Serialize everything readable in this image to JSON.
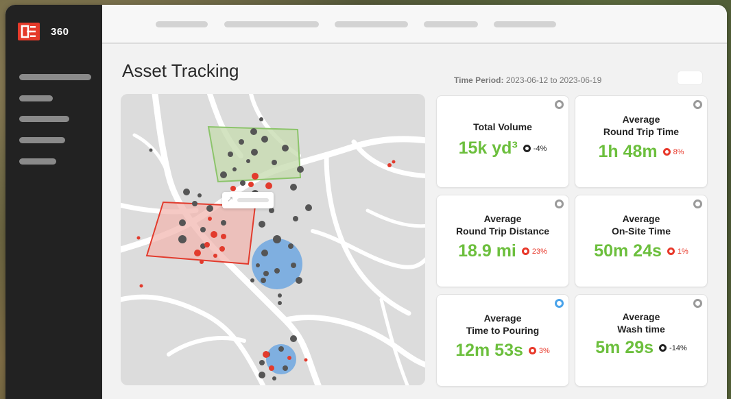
{
  "app": {
    "logo_text": "360"
  },
  "page": {
    "title": "Asset Tracking"
  },
  "time_period": {
    "label": "Time Period:",
    "value": "2023-06-12 to 2023-06-19"
  },
  "colors": {
    "accent": "#e53a2a",
    "metric_green": "#6cbf3d",
    "negative_red": "#e8382a",
    "sidebar": "#222222"
  },
  "icons": {
    "logo": "e-logo-icon",
    "card_select": "radio-icon",
    "tooltip_link": "external-link-icon"
  },
  "metrics": [
    {
      "title": "Total Volume",
      "value": "15k yd³",
      "change": "-4%",
      "trend": "black",
      "selected": false
    },
    {
      "title": "Average\nRound Trip Time",
      "value": "1h 48m",
      "change": "8%",
      "trend": "red",
      "selected": false
    },
    {
      "title": "Average\nRound Trip Distance",
      "value": "18.9 mi",
      "change": "23%",
      "trend": "red",
      "selected": false
    },
    {
      "title": "Average\nOn-Site Time",
      "value": "50m 24s",
      "change": "1%",
      "trend": "red",
      "selected": false
    },
    {
      "title": "Average\nTime to Pouring",
      "value": "12m 53s",
      "change": "3%",
      "trend": "red",
      "selected": true
    },
    {
      "title": "Average\nWash time",
      "value": "5m 29s",
      "change": "-14%",
      "trend": "black",
      "selected": false
    }
  ]
}
